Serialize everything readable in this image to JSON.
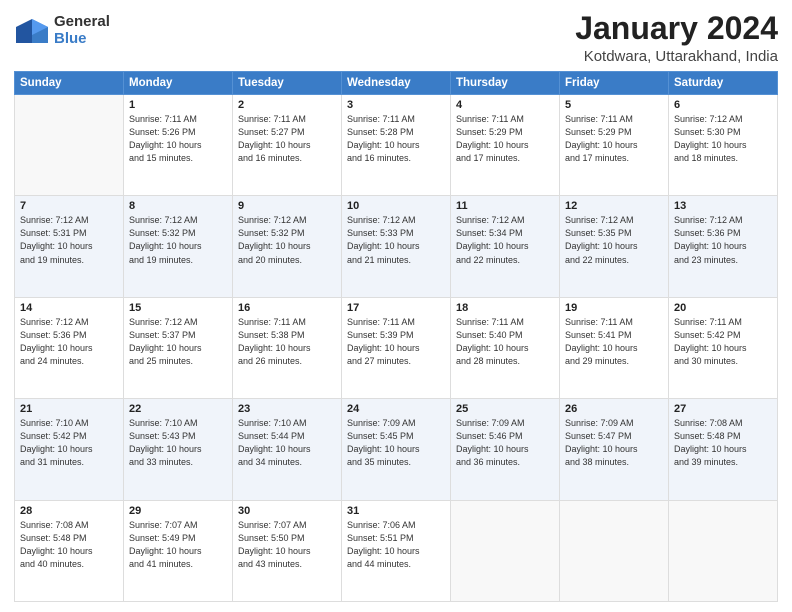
{
  "header": {
    "logo_general": "General",
    "logo_blue": "Blue",
    "title": "January 2024",
    "subtitle": "Kotdwara, Uttarakhand, India"
  },
  "days_of_week": [
    "Sunday",
    "Monday",
    "Tuesday",
    "Wednesday",
    "Thursday",
    "Friday",
    "Saturday"
  ],
  "weeks": [
    [
      {
        "day": "",
        "content": ""
      },
      {
        "day": "1",
        "content": "Sunrise: 7:11 AM\nSunset: 5:26 PM\nDaylight: 10 hours\nand 15 minutes."
      },
      {
        "day": "2",
        "content": "Sunrise: 7:11 AM\nSunset: 5:27 PM\nDaylight: 10 hours\nand 16 minutes."
      },
      {
        "day": "3",
        "content": "Sunrise: 7:11 AM\nSunset: 5:28 PM\nDaylight: 10 hours\nand 16 minutes."
      },
      {
        "day": "4",
        "content": "Sunrise: 7:11 AM\nSunset: 5:29 PM\nDaylight: 10 hours\nand 17 minutes."
      },
      {
        "day": "5",
        "content": "Sunrise: 7:11 AM\nSunset: 5:29 PM\nDaylight: 10 hours\nand 17 minutes."
      },
      {
        "day": "6",
        "content": "Sunrise: 7:12 AM\nSunset: 5:30 PM\nDaylight: 10 hours\nand 18 minutes."
      }
    ],
    [
      {
        "day": "7",
        "content": "Sunrise: 7:12 AM\nSunset: 5:31 PM\nDaylight: 10 hours\nand 19 minutes."
      },
      {
        "day": "8",
        "content": "Sunrise: 7:12 AM\nSunset: 5:32 PM\nDaylight: 10 hours\nand 19 minutes."
      },
      {
        "day": "9",
        "content": "Sunrise: 7:12 AM\nSunset: 5:32 PM\nDaylight: 10 hours\nand 20 minutes."
      },
      {
        "day": "10",
        "content": "Sunrise: 7:12 AM\nSunset: 5:33 PM\nDaylight: 10 hours\nand 21 minutes."
      },
      {
        "day": "11",
        "content": "Sunrise: 7:12 AM\nSunset: 5:34 PM\nDaylight: 10 hours\nand 22 minutes."
      },
      {
        "day": "12",
        "content": "Sunrise: 7:12 AM\nSunset: 5:35 PM\nDaylight: 10 hours\nand 22 minutes."
      },
      {
        "day": "13",
        "content": "Sunrise: 7:12 AM\nSunset: 5:36 PM\nDaylight: 10 hours\nand 23 minutes."
      }
    ],
    [
      {
        "day": "14",
        "content": "Sunrise: 7:12 AM\nSunset: 5:36 PM\nDaylight: 10 hours\nand 24 minutes."
      },
      {
        "day": "15",
        "content": "Sunrise: 7:12 AM\nSunset: 5:37 PM\nDaylight: 10 hours\nand 25 minutes."
      },
      {
        "day": "16",
        "content": "Sunrise: 7:11 AM\nSunset: 5:38 PM\nDaylight: 10 hours\nand 26 minutes."
      },
      {
        "day": "17",
        "content": "Sunrise: 7:11 AM\nSunset: 5:39 PM\nDaylight: 10 hours\nand 27 minutes."
      },
      {
        "day": "18",
        "content": "Sunrise: 7:11 AM\nSunset: 5:40 PM\nDaylight: 10 hours\nand 28 minutes."
      },
      {
        "day": "19",
        "content": "Sunrise: 7:11 AM\nSunset: 5:41 PM\nDaylight: 10 hours\nand 29 minutes."
      },
      {
        "day": "20",
        "content": "Sunrise: 7:11 AM\nSunset: 5:42 PM\nDaylight: 10 hours\nand 30 minutes."
      }
    ],
    [
      {
        "day": "21",
        "content": "Sunrise: 7:10 AM\nSunset: 5:42 PM\nDaylight: 10 hours\nand 31 minutes."
      },
      {
        "day": "22",
        "content": "Sunrise: 7:10 AM\nSunset: 5:43 PM\nDaylight: 10 hours\nand 33 minutes."
      },
      {
        "day": "23",
        "content": "Sunrise: 7:10 AM\nSunset: 5:44 PM\nDaylight: 10 hours\nand 34 minutes."
      },
      {
        "day": "24",
        "content": "Sunrise: 7:09 AM\nSunset: 5:45 PM\nDaylight: 10 hours\nand 35 minutes."
      },
      {
        "day": "25",
        "content": "Sunrise: 7:09 AM\nSunset: 5:46 PM\nDaylight: 10 hours\nand 36 minutes."
      },
      {
        "day": "26",
        "content": "Sunrise: 7:09 AM\nSunset: 5:47 PM\nDaylight: 10 hours\nand 38 minutes."
      },
      {
        "day": "27",
        "content": "Sunrise: 7:08 AM\nSunset: 5:48 PM\nDaylight: 10 hours\nand 39 minutes."
      }
    ],
    [
      {
        "day": "28",
        "content": "Sunrise: 7:08 AM\nSunset: 5:48 PM\nDaylight: 10 hours\nand 40 minutes."
      },
      {
        "day": "29",
        "content": "Sunrise: 7:07 AM\nSunset: 5:49 PM\nDaylight: 10 hours\nand 41 minutes."
      },
      {
        "day": "30",
        "content": "Sunrise: 7:07 AM\nSunset: 5:50 PM\nDaylight: 10 hours\nand 43 minutes."
      },
      {
        "day": "31",
        "content": "Sunrise: 7:06 AM\nSunset: 5:51 PM\nDaylight: 10 hours\nand 44 minutes."
      },
      {
        "day": "",
        "content": ""
      },
      {
        "day": "",
        "content": ""
      },
      {
        "day": "",
        "content": ""
      }
    ]
  ]
}
